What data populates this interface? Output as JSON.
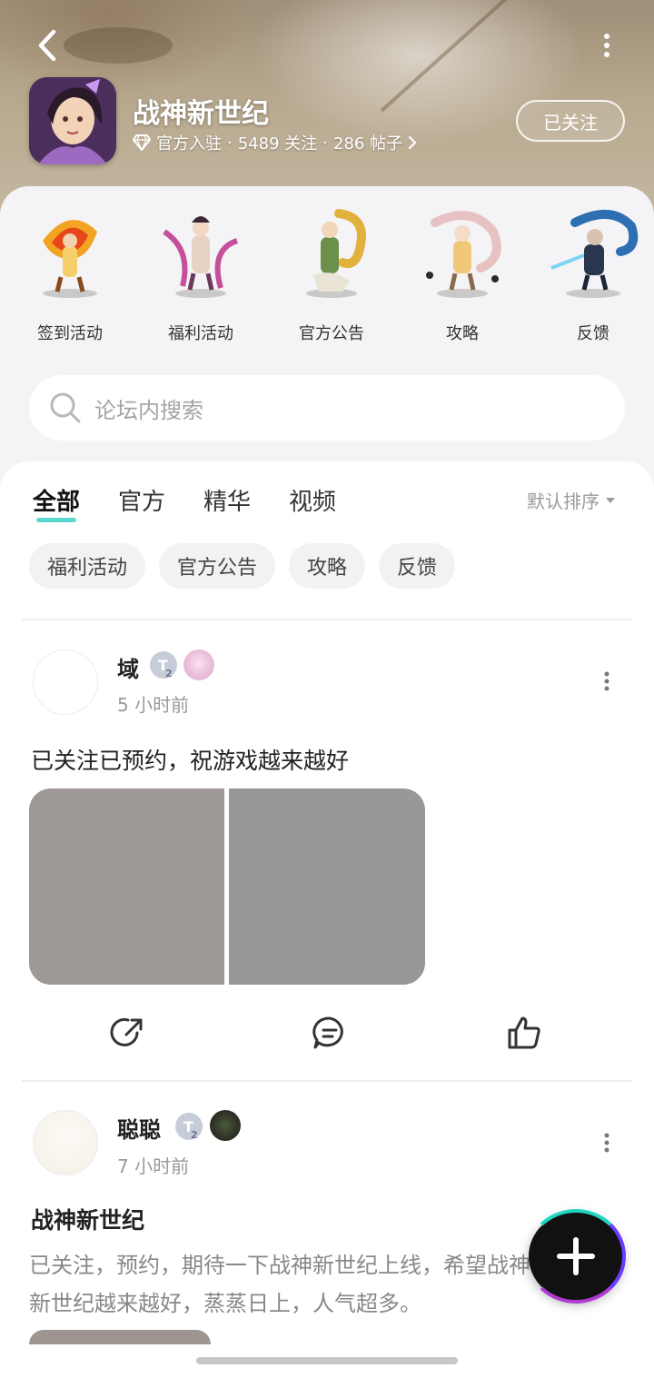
{
  "header": {
    "title": "战神新世纪",
    "official_label": "官方入驻",
    "followers": "5489 关注",
    "posts": "286 帖子",
    "separator": "·",
    "follow_button": "已关注",
    "icons": [
      "back-icon",
      "more-vertical-icon",
      "diamond-icon",
      "chevron-right-icon"
    ]
  },
  "categories": [
    {
      "label": "签到活动",
      "icon": "fire-warrior-icon"
    },
    {
      "label": "福利活动",
      "icon": "pink-dancer-icon"
    },
    {
      "label": "官方公告",
      "icon": "dragon-warrior-icon"
    },
    {
      "label": "攻略",
      "icon": "white-dragon-icon"
    },
    {
      "label": "反馈",
      "icon": "blue-dragon-icon"
    }
  ],
  "search": {
    "placeholder": "论坛内搜索"
  },
  "feed": {
    "tabs": [
      "全部",
      "官方",
      "精华",
      "视频"
    ],
    "active_tab": "全部",
    "sort_label": "默认排序",
    "chips": [
      "福利活动",
      "官方公告",
      "攻略",
      "反馈"
    ]
  },
  "posts": [
    {
      "author": "域",
      "level": "2",
      "time": "5 小时前",
      "text": "已关注已预约，祝游戏越来越好",
      "images": [
        "#9e9896",
        "#979996"
      ]
    },
    {
      "author": "聪聪",
      "level": "2",
      "time": "7 小时前",
      "title": "战神新世纪",
      "excerpt": "已关注，预约，期待一下战神新世纪上线，希望战神新世纪越来越好，蒸蒸日上，人气超多。"
    }
  ],
  "fab": {
    "icon": "plus-icon"
  },
  "colors": {
    "accent": "#3fd2c7",
    "background": "#f4f4f6"
  }
}
